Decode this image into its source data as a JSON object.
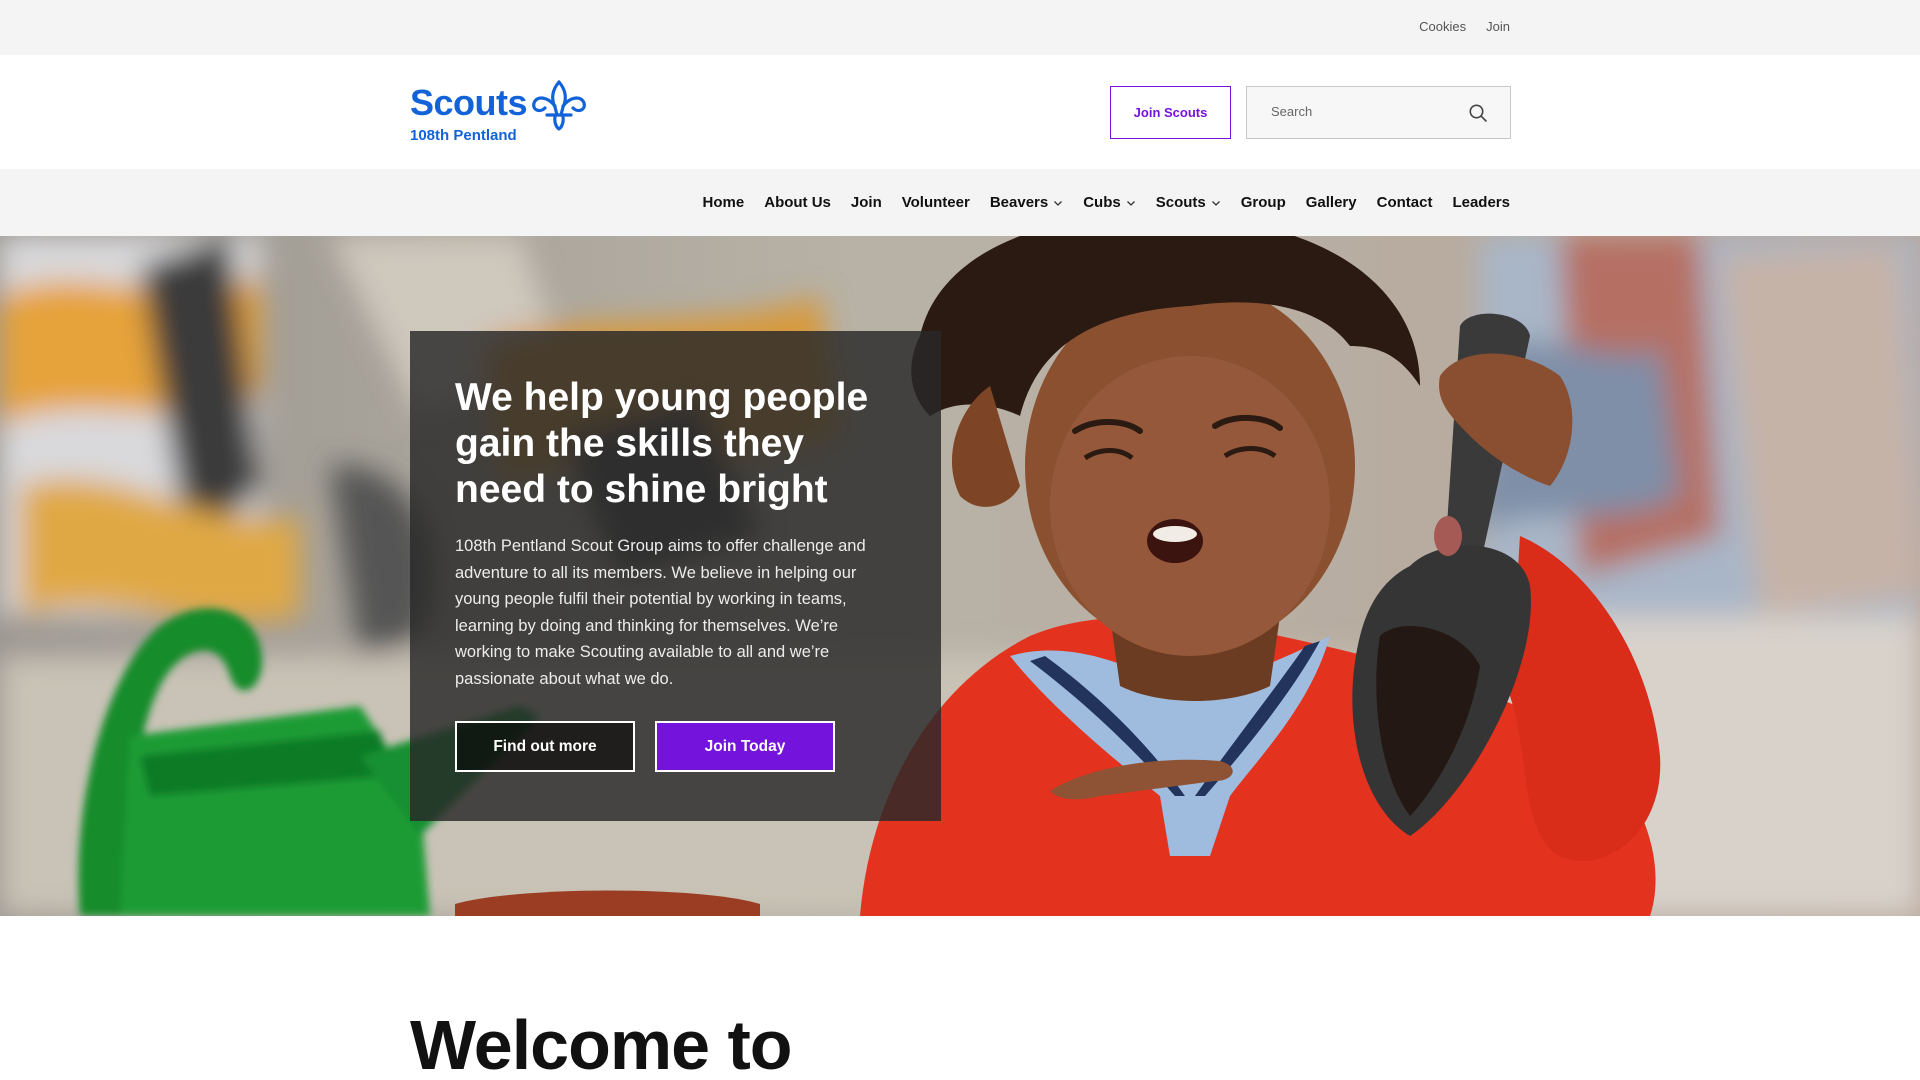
{
  "utility": {
    "links": [
      "Cookies",
      "Join"
    ]
  },
  "header": {
    "logo_text": "Scouts",
    "logo_subtitle": "108th Pentland",
    "join_button": "Join Scouts",
    "search_placeholder": "Search"
  },
  "nav": {
    "items": [
      {
        "label": "Home",
        "dropdown": false
      },
      {
        "label": "About Us",
        "dropdown": false
      },
      {
        "label": "Join",
        "dropdown": false
      },
      {
        "label": "Volunteer",
        "dropdown": false
      },
      {
        "label": "Beavers",
        "dropdown": true
      },
      {
        "label": "Cubs",
        "dropdown": true
      },
      {
        "label": "Scouts",
        "dropdown": true
      },
      {
        "label": "Group",
        "dropdown": false
      },
      {
        "label": "Gallery",
        "dropdown": false
      },
      {
        "label": "Contact",
        "dropdown": false
      },
      {
        "label": "Leaders",
        "dropdown": false
      }
    ]
  },
  "hero": {
    "title": "We help young people gain the skills they need to shine bright",
    "body": "108th Pentland Scout Group aims to offer challenge and adventure to all its members. We believe in helping our young people fulfil their potential by working in teams, learning by doing and thinking for themselves. We’re working to make Scouting available to all and we’re passionate about what we do.",
    "secondary_button": "Find out more",
    "primary_button": "Join Today"
  },
  "welcome": {
    "heading": "Welcome to"
  },
  "colors": {
    "brand_blue": "#1363d8",
    "brand_purple": "#7413dc"
  }
}
